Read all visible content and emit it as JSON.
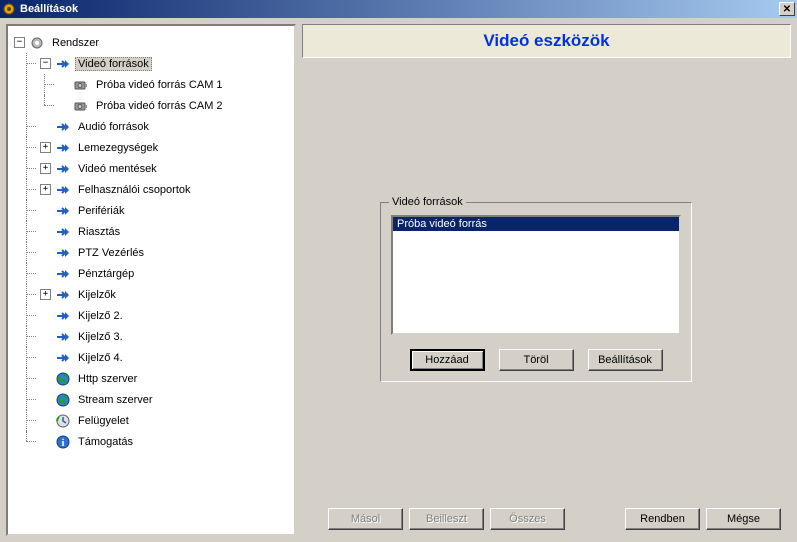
{
  "window": {
    "title": "Beállítások"
  },
  "header": {
    "title": "Videó eszközök"
  },
  "tree": {
    "root": "Rendszer",
    "items": [
      {
        "label": "Videó források",
        "icon": "arrow",
        "expand": "minus",
        "selected": true,
        "children": [
          {
            "label": "Próba videó forrás CAM 1",
            "icon": "camera"
          },
          {
            "label": "Próba videó forrás CAM 2",
            "icon": "camera"
          }
        ]
      },
      {
        "label": "Audió források",
        "icon": "arrow"
      },
      {
        "label": "Lemezegységek",
        "icon": "arrow",
        "expand": "plus"
      },
      {
        "label": "Videó mentések",
        "icon": "arrow",
        "expand": "plus"
      },
      {
        "label": "Felhasználói csoportok",
        "icon": "arrow",
        "expand": "plus"
      },
      {
        "label": "Perifériák",
        "icon": "arrow"
      },
      {
        "label": "Riasztás",
        "icon": "arrow"
      },
      {
        "label": "PTZ Vezérlés",
        "icon": "arrow"
      },
      {
        "label": "Pénztárgép",
        "icon": "arrow"
      },
      {
        "label": "Kijelzők",
        "icon": "arrow",
        "expand": "plus"
      },
      {
        "label": "Kijelző 2.",
        "icon": "arrow"
      },
      {
        "label": "Kijelző 3.",
        "icon": "arrow"
      },
      {
        "label": "Kijelző 4.",
        "icon": "arrow"
      },
      {
        "label": "Http szerver",
        "icon": "globe"
      },
      {
        "label": "Stream szerver",
        "icon": "globe"
      },
      {
        "label": "Felügyelet",
        "icon": "history"
      },
      {
        "label": "Támogatás",
        "icon": "info"
      }
    ]
  },
  "sources": {
    "legend": "Videó források",
    "items": [
      {
        "label": "Próba videó forrás",
        "selected": true
      }
    ],
    "buttons": {
      "add": "Hozzáad",
      "delete": "Töröl",
      "settings": "Beállítások"
    }
  },
  "bottom": {
    "copy": "Másol",
    "paste": "Beilleszt",
    "all": "Összes",
    "ok": "Rendben",
    "cancel": "Mégse"
  }
}
